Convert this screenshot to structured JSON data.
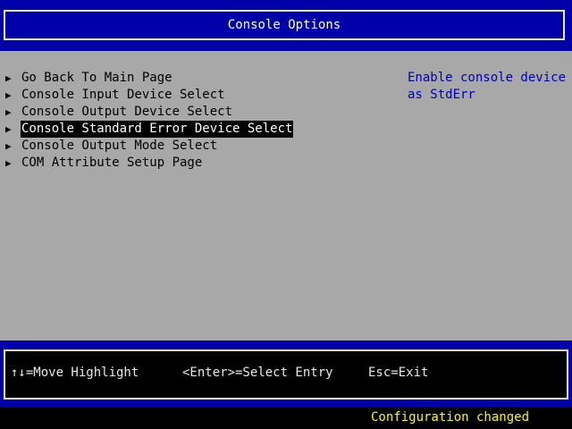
{
  "header": {
    "title": "Console Options"
  },
  "menu": {
    "items": [
      {
        "label": "Go Back To Main Page",
        "selected": false
      },
      {
        "label": "Console Input Device Select",
        "selected": false
      },
      {
        "label": "Console Output Device Select",
        "selected": false
      },
      {
        "label": "Console Standard Error Device Select",
        "selected": true
      },
      {
        "label": "Console Output Mode Select",
        "selected": false
      },
      {
        "label": "COM Attribute Setup Page",
        "selected": false
      }
    ],
    "arrow_icon": "triangle-right-icon"
  },
  "help": {
    "text": "Enable console device\nas StdErr"
  },
  "footer": {
    "move_hint": "↑↓=Move Highlight",
    "select_hint": "<Enter>=Select Entry",
    "exit_hint": "Esc=Exit"
  },
  "status": {
    "message": "Configuration changed"
  },
  "colors": {
    "title_band": "#0000a8",
    "panel": "#a8a8a8",
    "help_text": "#0000a8",
    "status_text": "#f8f800",
    "highlight_bg": "#000000",
    "highlight_fg": "#ffffff"
  }
}
